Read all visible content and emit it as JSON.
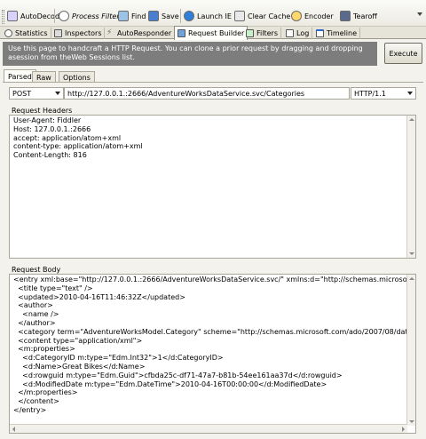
{
  "toolbar": {
    "items": [
      "AutoDecode",
      "Process Filter",
      "Find",
      "Save",
      "Launch IE",
      "Clear Cache",
      "Encoder",
      "Tearoff"
    ]
  },
  "tabs": [
    "Statistics",
    "Inspectors",
    "AutoResponder",
    "Request Builder",
    "Filters",
    "Log",
    "Timeline"
  ],
  "info": {
    "text": "Use this page to handcraft a HTTP Request. You can clone a prior request by dragging and dropping asession from theWeb Sessions list.",
    "execute_label": "Execute"
  },
  "subtabs": [
    "Parsed",
    "Raw",
    "Options"
  ],
  "request_line": {
    "method": "POST",
    "url": "http://127.0.0.1.:2666/AdventureWorksDataService.svc/Categories",
    "version": "HTTP/1.1"
  },
  "headers": {
    "label": "Request Headers",
    "text": "User-Agent: Fiddler\nHost: 127.0.0.1.:2666\naccept: application/atom+xml\ncontent-type: application/atom+xml\nContent-Length: 816"
  },
  "body": {
    "label": "Request Body",
    "text": "<entry xml:base=\"http://127.0.0.1.:2666/AdventureWorksDataService.svc/\" xmlns:d=\"http://schemas.microsoft.com/ado/20\n  <title type=\"text\" />\n  <updated>2010-04-16T11:46:32Z</updated>\n  <author>\n    <name />\n  </author>\n  <category term=\"AdventureWorksModel.Category\" scheme=\"http://schemas.microsoft.com/ado/2007/08/dataservices/scher\n  <content type=\"application/xml\">\n  <m:properties>\n    <d:CategoryID m:type=\"Edm.Int32\">1</d:CategoryID>\n    <d:Name>Great Bikes</d:Name>\n    <d:rowguid m:type=\"Edm.Guid\">cfbda25c-df71-47a7-b81b-54ee161aa37d</d:rowguid>\n    <d:ModifiedDate m:type=\"Edm.DateTime\">2010-04-16T00:00:00</d:ModifiedDate>\n  </m:properties>\n  </content>\n</entry>"
  },
  "colors": {
    "info_bg": "#7d7d7d",
    "window_bg": "#f3f2ec"
  }
}
